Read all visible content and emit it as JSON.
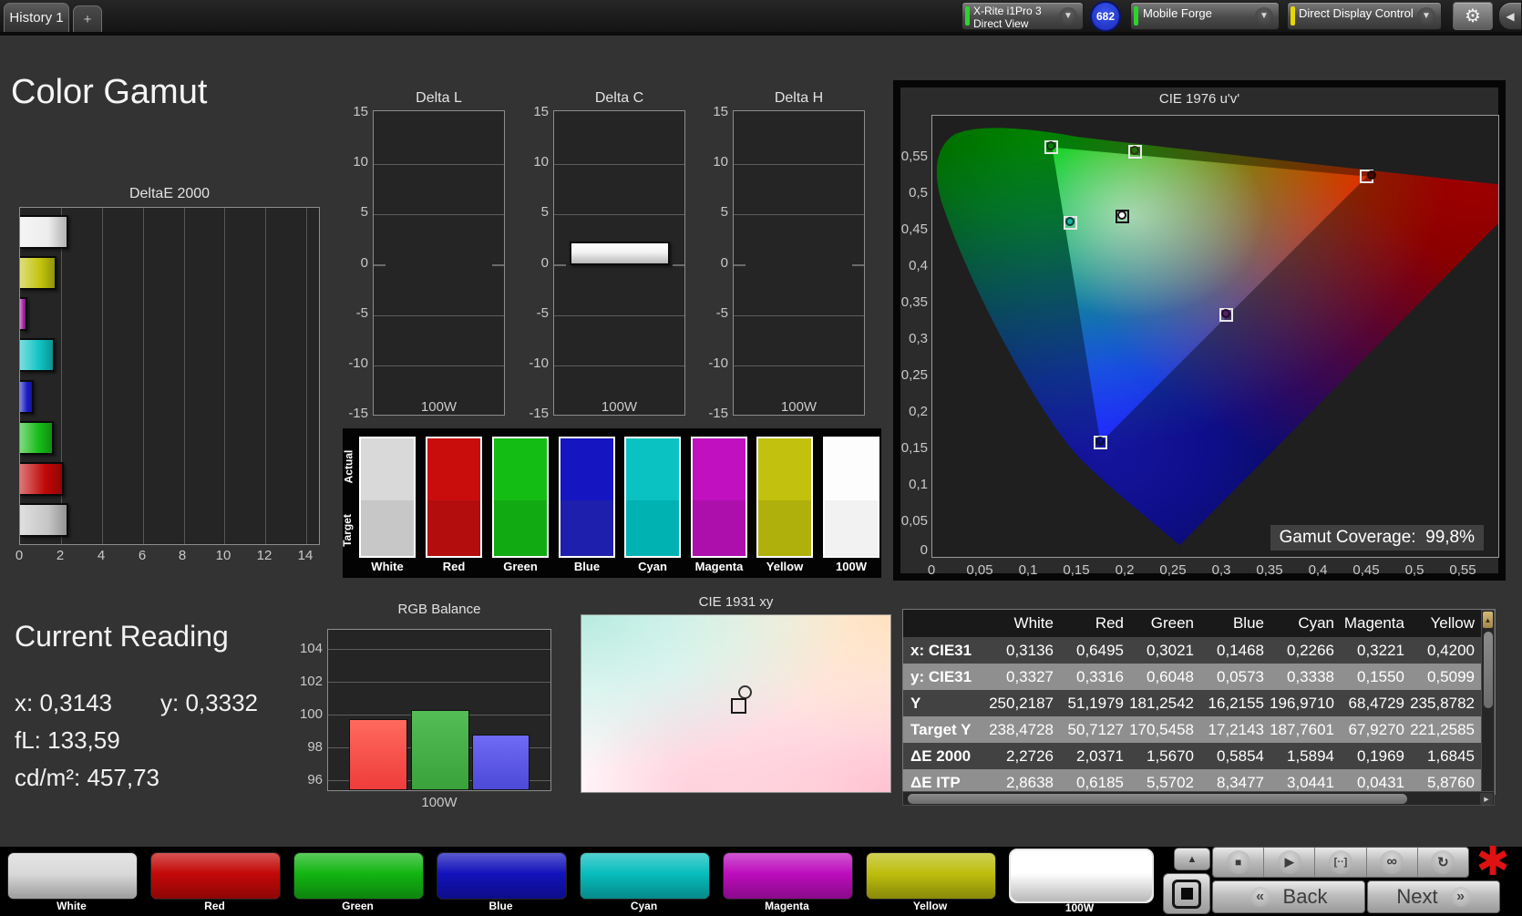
{
  "icons": {
    "add": "+",
    "dropdown": "▼",
    "gear": "⚙",
    "collapse": "◀",
    "stop": "■",
    "play": "▶",
    "interval": "[··]",
    "loop": "∞",
    "refresh": "↻",
    "up": "▲",
    "back_chevron": "«",
    "next_chevron": "»",
    "asterisk": "✱",
    "scroll_right": "▶",
    "scroll_up": "▲"
  },
  "tabs": {
    "history": "History 1"
  },
  "topbar": {
    "meter": {
      "line1": "X-Rite i1Pro 3",
      "line2": "Direct View",
      "badge": "682",
      "stripe_color": "#2ed22e"
    },
    "source": {
      "label": "Mobile Forge",
      "stripe_color": "#2ed22e"
    },
    "control": {
      "label": "Direct Display Control",
      "stripe_color": "#e8d800"
    }
  },
  "page": {
    "title": "Color Gamut"
  },
  "charts": {
    "deltae": {
      "type": "bar",
      "title": "DeltaE 2000",
      "categories": [
        "White",
        "Yellow",
        "Magenta",
        "Cyan",
        "Blue",
        "Green",
        "Red",
        "100W"
      ],
      "values": [
        2.27,
        1.68,
        0.2,
        1.59,
        0.59,
        1.57,
        2.04,
        2.27
      ],
      "colors": [
        "#ededed",
        "#c3c30d",
        "#a326a3",
        "#10c3c3",
        "#1b1bc6",
        "#17bb17",
        "#c00808",
        "#c6c6c6"
      ],
      "xticks": [
        "0",
        "2",
        "4",
        "6",
        "8",
        "10",
        "12",
        "14"
      ],
      "xlim": [
        0,
        14.7
      ]
    },
    "delta": {
      "yticks": [
        "15",
        "10",
        "5",
        "0",
        "-5",
        "-10",
        "-15"
      ],
      "ylim": [
        -15,
        15
      ],
      "charts": [
        {
          "title": "Delta L",
          "xlabel": "100W",
          "value": 0
        },
        {
          "title": "Delta C",
          "xlabel": "100W",
          "value": 2.3
        },
        {
          "title": "Delta H",
          "xlabel": "100W",
          "value": 0
        }
      ]
    },
    "rgb_balance": {
      "type": "bar",
      "title": "RGB Balance",
      "series": [
        "Red",
        "Green",
        "Blue"
      ],
      "values": [
        99.7,
        100.3,
        98.8
      ],
      "yticks": [
        "104",
        "102",
        "100",
        "98",
        "96"
      ],
      "xlabel": "100W"
    },
    "cie1976": {
      "type": "scatter",
      "title": "CIE 1976 u'v'",
      "yticks": [
        "0,55",
        "0,5",
        "0,45",
        "0,4",
        "0,35",
        "0,3",
        "0,25",
        "0,2",
        "0,15",
        "0,1",
        "0,05",
        "0"
      ],
      "xticks": [
        "0",
        "0,05",
        "0,1",
        "0,15",
        "0,2",
        "0,25",
        "0,3",
        "0,35",
        "0,4",
        "0,45",
        "0,5",
        "0,55"
      ],
      "gamut_label": "Gamut Coverage:",
      "gamut_value": "99,8%",
      "points": [
        {
          "name": "green",
          "u": 0.125,
          "v": 0.563
        },
        {
          "name": "yellow",
          "u": 0.211,
          "v": 0.556
        },
        {
          "name": "red",
          "u": 0.451,
          "v": 0.523
        },
        {
          "name": "white",
          "u": 0.198,
          "v": 0.468
        },
        {
          "name": "cyan",
          "u": 0.144,
          "v": 0.459
        },
        {
          "name": "magenta",
          "u": 0.306,
          "v": 0.332
        },
        {
          "name": "blue",
          "u": 0.175,
          "v": 0.158
        }
      ]
    },
    "cie1931": {
      "title": "CIE 1931 xy"
    }
  },
  "swatch_strip": {
    "actual_label": "Actual",
    "target_label": "Target",
    "columns": [
      {
        "name": "White",
        "actual": "#d9d9d9",
        "target": "#c7c7c7"
      },
      {
        "name": "Red",
        "actual": "#c90d0d",
        "target": "#b30d0d"
      },
      {
        "name": "Green",
        "actual": "#14bd14",
        "target": "#12aa12"
      },
      {
        "name": "Blue",
        "actual": "#1515c2",
        "target": "#1f1fae"
      },
      {
        "name": "Cyan",
        "actual": "#0ac2c2",
        "target": "#00b2b2"
      },
      {
        "name": "Magenta",
        "actual": "#c010c0",
        "target": "#ad0fad"
      },
      {
        "name": "Yellow",
        "actual": "#c2c20e",
        "target": "#b0b00c"
      },
      {
        "name": "100W",
        "actual": "#fdfdfd",
        "target": "#f2f2f2"
      }
    ]
  },
  "reading": {
    "title": "Current Reading",
    "x_label": "x:",
    "x_value": "0,3143",
    "y_label": "y:",
    "y_value": "0,3332",
    "fl_label": "fL:",
    "fl_value": "133,59",
    "cd_label": "cd/m²:",
    "cd_value": "457,73"
  },
  "table": {
    "columns": [
      "White",
      "Red",
      "Green",
      "Blue",
      "Cyan",
      "Magenta",
      "Yellow"
    ],
    "rows": [
      {
        "label": "x: CIE31",
        "values": [
          "0,3136",
          "0,6495",
          "0,3021",
          "0,1468",
          "0,2266",
          "0,3221",
          "0,4200"
        ]
      },
      {
        "label": "y: CIE31",
        "values": [
          "0,3327",
          "0,3316",
          "0,6048",
          "0,0573",
          "0,3338",
          "0,1550",
          "0,5099"
        ]
      },
      {
        "label": "Y",
        "values": [
          "250,2187",
          "51,1979",
          "181,2542",
          "16,2155",
          "196,9710",
          "68,4729",
          "235,8782"
        ]
      },
      {
        "label": "Target Y",
        "values": [
          "238,4728",
          "50,7127",
          "170,5458",
          "17,2143",
          "187,7601",
          "67,9270",
          "221,2585"
        ]
      },
      {
        "label": "ΔE 2000",
        "values": [
          "2,2726",
          "2,0371",
          "1,5670",
          "0,5854",
          "1,5894",
          "0,1969",
          "1,6845"
        ]
      },
      {
        "label": "ΔE ITP",
        "values": [
          "2,8638",
          "0,6185",
          "5,5702",
          "8,3477",
          "3,0441",
          "0,0431",
          "5,8760"
        ]
      }
    ]
  },
  "bottom": {
    "patches": [
      {
        "label": "White",
        "color": "#d9d9d9"
      },
      {
        "label": "Red",
        "color": "#c40808"
      },
      {
        "label": "Green",
        "color": "#12b512"
      },
      {
        "label": "Blue",
        "color": "#1212bb"
      },
      {
        "label": "Cyan",
        "color": "#08bdbd"
      },
      {
        "label": "Magenta",
        "color": "#bd0dbd"
      },
      {
        "label": "Yellow",
        "color": "#bdbd0d"
      },
      {
        "label": "100W",
        "color": "#ffffff"
      }
    ],
    "back_label": "Back",
    "next_label": "Next"
  }
}
